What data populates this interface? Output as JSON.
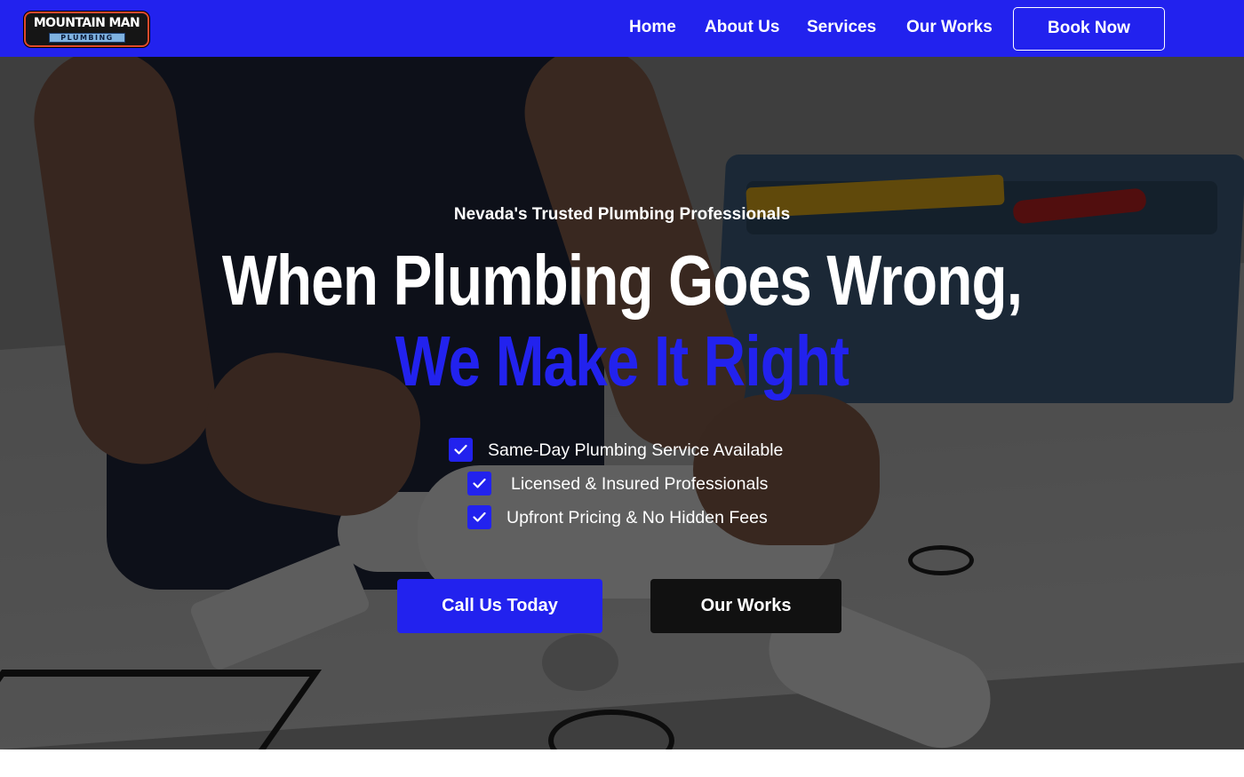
{
  "brand": {
    "logo_line1": "MOUNTAIN MAN",
    "logo_line2": "PLUMBING"
  },
  "nav": {
    "links": [
      {
        "label": "Home"
      },
      {
        "label": "About Us"
      },
      {
        "label": "Services"
      },
      {
        "label": "Our Works"
      }
    ],
    "cta_label": "Book Now"
  },
  "hero": {
    "tagline": "Nevada's Trusted Plumbing Professionals",
    "headline": "When Plumbing Goes Wrong,",
    "headline_accent": "We Make It Right",
    "checklist": [
      {
        "text": "Same-Day Plumbing Service Available"
      },
      {
        "text": "Licensed & Insured Professionals"
      },
      {
        "text": "Upfront Pricing & No Hidden Fees"
      }
    ],
    "primary_button": "Call Us Today",
    "secondary_button": "Our Works"
  },
  "theme": {
    "accent": "#2222ee",
    "dark_button": "#111111",
    "logo_border": "#e04a2a"
  },
  "icons": {
    "check": "check-icon"
  }
}
